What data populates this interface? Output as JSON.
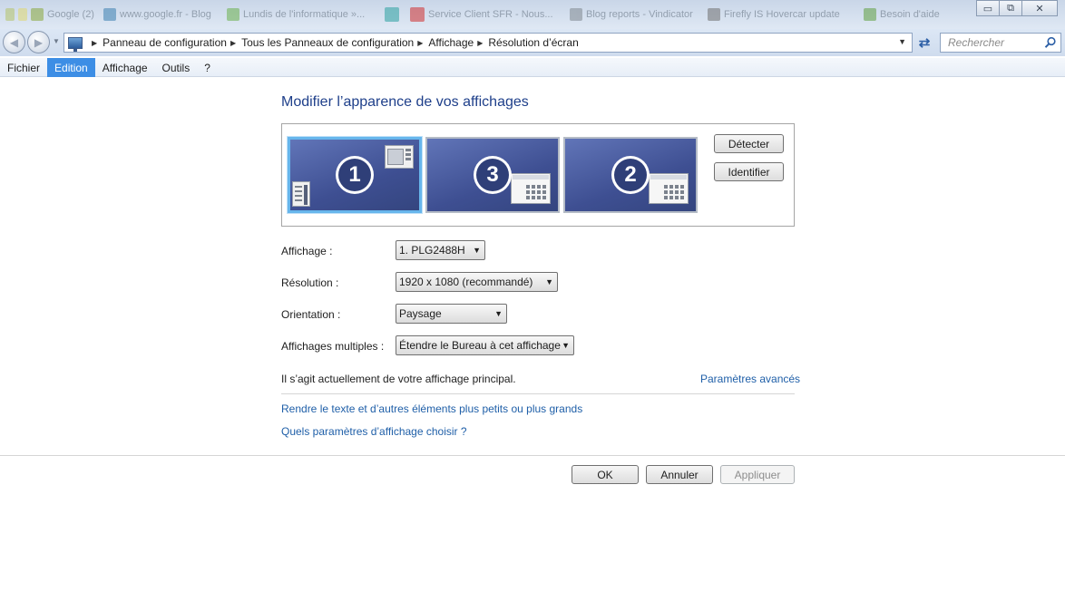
{
  "taskbar": {
    "tabs": [
      {
        "label": "Google (2)",
        "color": "#8aa83c"
      },
      {
        "label": "www.google.fr - Blog",
        "color": "#3b7fb0"
      },
      {
        "label": "Lundis de l'informatique »...",
        "color": "#6ab04c"
      },
      {
        "label": "",
        "color": "#2aa0a0"
      },
      {
        "label": "Service Client SFR - Nous...",
        "color": "#d03030"
      },
      {
        "label": "Blog reports - Vindicator",
        "color": "#808890"
      },
      {
        "label": "Firefly IS Hovercar update",
        "color": "#707070"
      },
      {
        "label": "Besoin d'aide",
        "color": "#60a040"
      }
    ]
  },
  "window_controls": {
    "minimize": "▭",
    "restore": "⧉",
    "close": "✕"
  },
  "address": {
    "breadcrumbs": [
      "Panneau de configuration",
      "Tous les Panneaux de configuration",
      "Affichage",
      "Résolution d’écran"
    ],
    "search_placeholder": "Rechercher"
  },
  "menu": {
    "items": [
      "Fichier",
      "Edition",
      "Affichage",
      "Outils",
      "?"
    ],
    "active": "Edition"
  },
  "page": {
    "title": "Modifier l’apparence de vos affichages",
    "monitors": [
      {
        "number": "1",
        "selected": true
      },
      {
        "number": "3",
        "selected": false
      },
      {
        "number": "2",
        "selected": false
      }
    ],
    "detect_button": "Détecter",
    "identify_button": "Identifier",
    "fields": {
      "display": {
        "label": "Affichage :",
        "value": "1. PLG2488H"
      },
      "resolution": {
        "label": "Résolution :",
        "value": "1920 x 1080 (recommandé)"
      },
      "orientation": {
        "label": "Orientation :",
        "value": "Paysage"
      },
      "multiple": {
        "label": "Affichages multiples :",
        "value": "Étendre le Bureau à cet affichage"
      }
    },
    "status_text": "Il s’agit actuellement de votre affichage principal.",
    "advanced_link": "Paramètres avancés",
    "text_size_link": "Rendre le texte et d’autres éléments plus petits ou plus grands",
    "which_settings_link": "Quels paramètres d’affichage choisir ?",
    "ok_button": "OK",
    "cancel_button": "Annuler",
    "apply_button": "Appliquer"
  }
}
